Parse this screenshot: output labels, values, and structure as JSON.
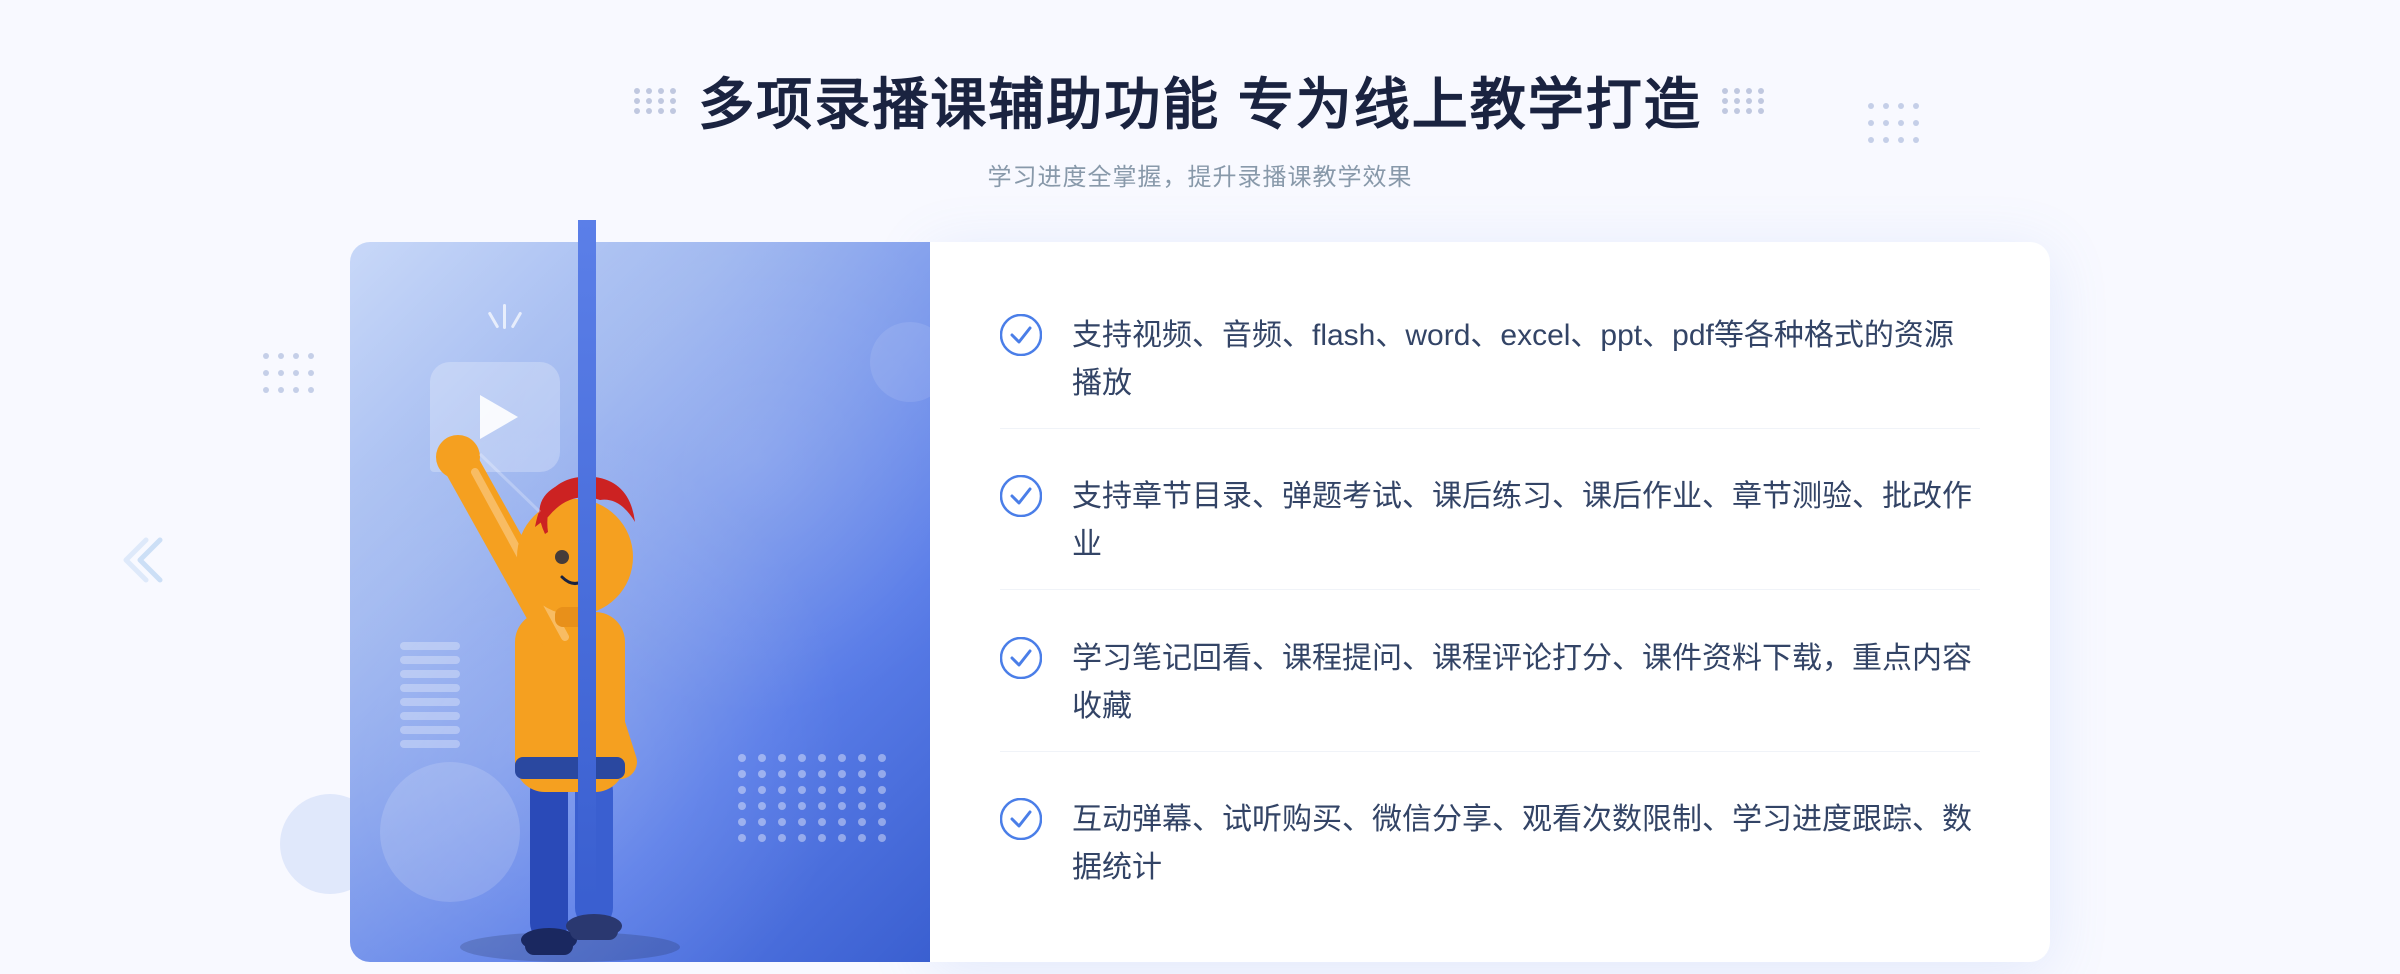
{
  "header": {
    "title": "多项录播课辅助功能 专为线上教学打造",
    "subtitle": "学习进度全掌握，提升录播课教学效果"
  },
  "features": [
    {
      "id": "feature-1",
      "text": "支持视频、音频、flash、word、excel、ppt、pdf等各种格式的资源播放"
    },
    {
      "id": "feature-2",
      "text": "支持章节目录、弹题考试、课后练习、课后作业、章节测验、批改作业"
    },
    {
      "id": "feature-3",
      "text": "学习笔记回看、课程提问、课程评论打分、课件资料下载，重点内容收藏"
    },
    {
      "id": "feature-4",
      "text": "互动弹幕、试听购买、微信分享、观看次数限制、学习进度跟踪、数据统计"
    }
  ],
  "colors": {
    "accent_blue": "#4a7ee8",
    "dark_blue": "#3a5fd0",
    "light_blue": "#c8d8f8",
    "text_dark": "#1a2340",
    "text_gray": "#8899aa",
    "text_body": "#334466"
  }
}
